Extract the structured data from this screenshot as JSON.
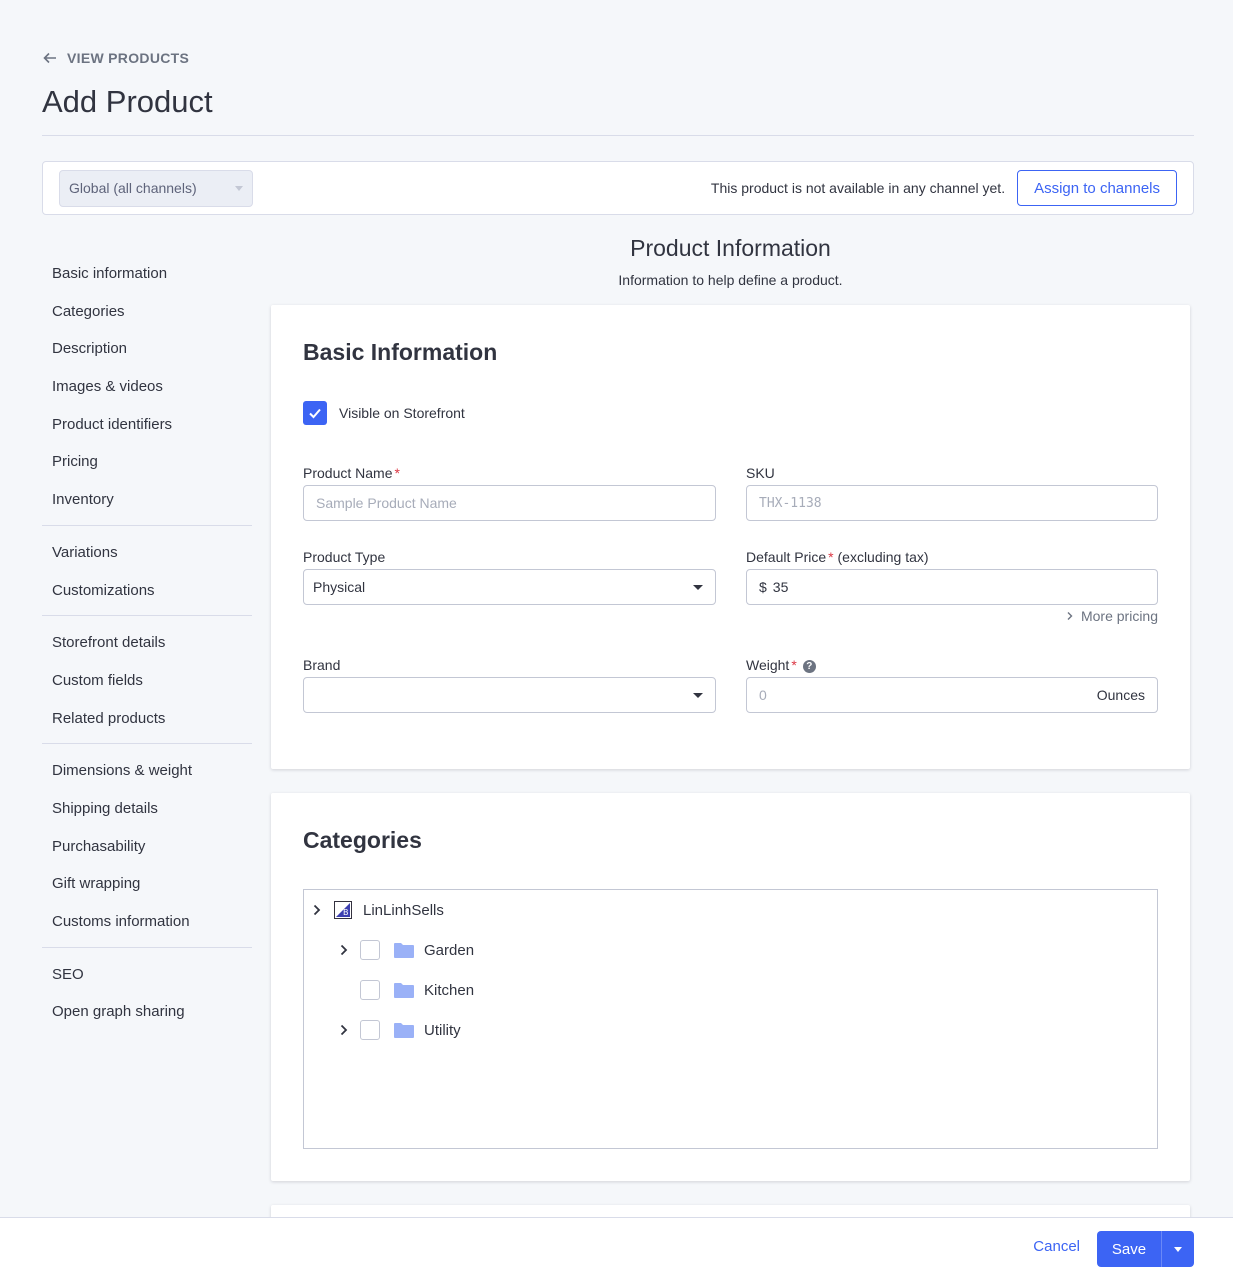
{
  "header": {
    "back_label": "VIEW PRODUCTS",
    "title": "Add Product"
  },
  "channels": {
    "select_value": "Global (all channels)",
    "note": "This product is not available in any channel yet.",
    "assign_label": "Assign to channels"
  },
  "sidebar": {
    "groups": [
      [
        "Basic information",
        "Categories",
        "Description",
        "Images & videos",
        "Product identifiers",
        "Pricing",
        "Inventory"
      ],
      [
        "Variations",
        "Customizations"
      ],
      [
        "Storefront details",
        "Custom fields",
        "Related products"
      ],
      [
        "Dimensions & weight",
        "Shipping details",
        "Purchasability",
        "Gift wrapping",
        "Customs information"
      ],
      [
        "SEO",
        "Open graph sharing"
      ]
    ]
  },
  "section": {
    "title": "Product Information",
    "subtitle": "Information to help define a product."
  },
  "basic": {
    "title": "Basic Information",
    "visible_label": "Visible on Storefront",
    "visible_checked": true,
    "product_name_label": "Product Name",
    "product_name_placeholder": "Sample Product Name",
    "sku_label": "SKU",
    "sku_placeholder": "THX-1138",
    "product_type_label": "Product Type",
    "product_type_value": "Physical",
    "default_price_label": "Default Price",
    "default_price_suffix": "(excluding tax)",
    "price_currency": "$",
    "price_value": "35",
    "more_pricing": "More pricing",
    "brand_label": "Brand",
    "brand_value": "",
    "weight_label": "Weight",
    "weight_placeholder": "0",
    "weight_unit": "Ounces",
    "required_mark": "*",
    "help_glyph": "?"
  },
  "categories": {
    "title": "Categories",
    "root": "LinLinhSells",
    "items": [
      {
        "label": "Garden",
        "expandable": true,
        "checked": false
      },
      {
        "label": "Kitchen",
        "expandable": false,
        "checked": false
      },
      {
        "label": "Utility",
        "expandable": true,
        "checked": false
      }
    ]
  },
  "footer": {
    "cancel_label": "Cancel",
    "save_label": "Save"
  },
  "colors": {
    "accent": "#3c64f4",
    "background": "#f5f7fa",
    "required": "#db3643"
  }
}
